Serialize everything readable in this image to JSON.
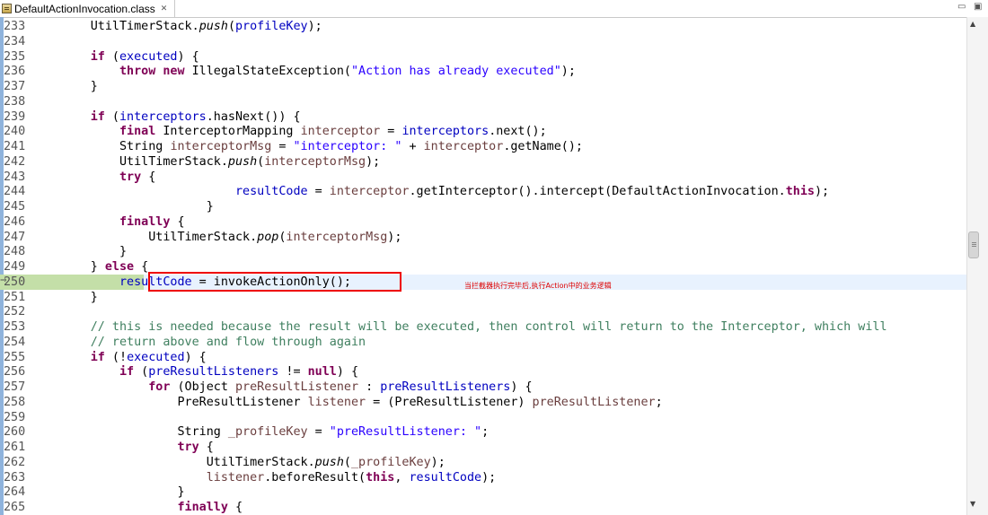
{
  "tab": {
    "label": "DefaultActionInvocation.class",
    "close": "✕"
  },
  "window": {
    "minimize": "▭",
    "maximize": "▣"
  },
  "annotation": "当拦截器执行完毕后,执行Action中的业务逻辑",
  "lines": [
    {
      "n": "233",
      "code": "            <span class=\"ty\">UtilTimerStack</span>.<span class=\"it\">push</span>(<span class=\"fd\">profileKey</span>);"
    },
    {
      "n": "234",
      "code": ""
    },
    {
      "n": "235",
      "code": "            <span class=\"kw\">if</span> (<span class=\"fd\">executed</span>) {"
    },
    {
      "n": "236",
      "code": "                <span class=\"kw\">throw</span> <span class=\"kw\">new</span> IllegalStateException(<span class=\"str\">\"Action has already executed\"</span>);"
    },
    {
      "n": "237",
      "code": "            }"
    },
    {
      "n": "238",
      "code": ""
    },
    {
      "n": "239",
      "code": "            <span class=\"kw\">if</span> (<span class=\"fd\">interceptors</span>.hasNext()) {"
    },
    {
      "n": "240",
      "code": "                <span class=\"kw\">final</span> InterceptorMapping <span class=\"lv\">interceptor</span> = <span class=\"fd\">interceptors</span>.next();"
    },
    {
      "n": "241",
      "code": "                String <span class=\"lv\">interceptorMsg</span> = <span class=\"str\">\"interceptor: \"</span> + <span class=\"lv\">interceptor</span>.getName();"
    },
    {
      "n": "242",
      "code": "                UtilTimerStack.<span class=\"it\">push</span>(<span class=\"lv\">interceptorMsg</span>);"
    },
    {
      "n": "243",
      "code": "                <span class=\"kw\">try</span> {"
    },
    {
      "n": "244",
      "code": "                                <span class=\"fd\">resultCode</span> = <span class=\"lv\">interceptor</span>.getInterceptor().intercept(DefaultActionInvocation.<span class=\"kw\">this</span>);"
    },
    {
      "n": "245",
      "code": "                            }"
    },
    {
      "n": "246",
      "code": "                <span class=\"kw\">finally</span> {"
    },
    {
      "n": "247",
      "code": "                    UtilTimerStack.<span class=\"it\">pop</span>(<span class=\"lv\">interceptorMsg</span>);"
    },
    {
      "n": "248",
      "code": "                }"
    },
    {
      "n": "249",
      "code": "            } <span class=\"kw\">else</span> {"
    },
    {
      "n": "250",
      "code": "                <span class=\"fd\">resultCode</span> = invokeActionOnly();",
      "current": true
    },
    {
      "n": "251",
      "code": "            }"
    },
    {
      "n": "252",
      "code": ""
    },
    {
      "n": "253",
      "code": "            <span class=\"cm\">// this is needed because the result will be executed, then control will return to the Interceptor, which will</span>"
    },
    {
      "n": "254",
      "code": "            <span class=\"cm\">// return above and flow through again</span>"
    },
    {
      "n": "255",
      "code": "            <span class=\"kw\">if</span> (!<span class=\"fd\">executed</span>) {"
    },
    {
      "n": "256",
      "code": "                <span class=\"kw\">if</span> (<span class=\"fd\">preResultListeners</span> != <span class=\"kw\">null</span>) {"
    },
    {
      "n": "257",
      "code": "                    <span class=\"kw\">for</span> (Object <span class=\"lv\">preResultListener</span> : <span class=\"fd\">preResultListeners</span>) {"
    },
    {
      "n": "258",
      "code": "                        PreResultListener <span class=\"lv\">listener</span> = (PreResultListener) <span class=\"lv\">preResultListener</span>;"
    },
    {
      "n": "259",
      "code": ""
    },
    {
      "n": "260",
      "code": "                        String <span class=\"lv\">_profileKey</span> = <span class=\"str\">\"preResultListener: \"</span>;"
    },
    {
      "n": "261",
      "code": "                        <span class=\"kw\">try</span> {"
    },
    {
      "n": "262",
      "code": "                            UtilTimerStack.<span class=\"it\">push</span>(<span class=\"lv\">_profileKey</span>);"
    },
    {
      "n": "263",
      "code": "                            <span class=\"lv\">listener</span>.beforeResult(<span class=\"kw\">this</span>, <span class=\"fd\">resultCode</span>);"
    },
    {
      "n": "264",
      "code": "                        }"
    },
    {
      "n": "265",
      "code": "                        <span class=\"kw\">finally</span> {"
    }
  ],
  "colors": {
    "keyword": "#7f0055",
    "field": "#0000c0",
    "string": "#2a00ff",
    "comment": "#3f7f5f",
    "local": "#6a3e3e"
  }
}
